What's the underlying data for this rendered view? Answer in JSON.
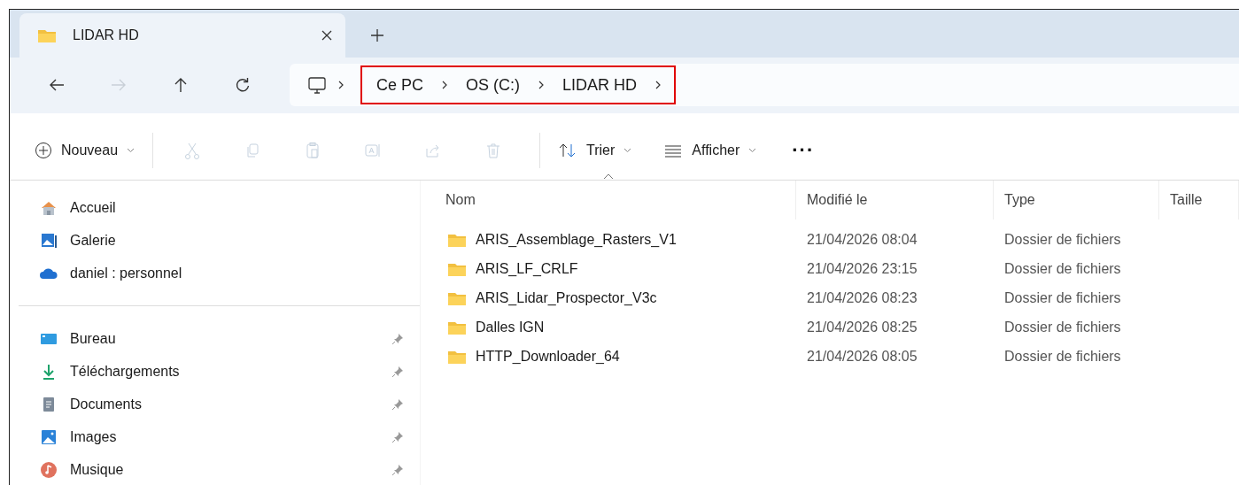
{
  "tab": {
    "title": "LIDAR HD",
    "selected": true
  },
  "nav_buttons": [
    {
      "kind": "back",
      "disabled": false
    },
    {
      "kind": "forward",
      "disabled": true
    },
    {
      "kind": "up",
      "disabled": false
    },
    {
      "kind": "refresh",
      "disabled": false
    }
  ],
  "breadcrumb": [
    "Ce PC",
    "OS (C:)",
    "LIDAR HD"
  ],
  "toolbar": {
    "new_label": "Nouveau",
    "actions": [
      {
        "kind": "cut",
        "disabled": true
      },
      {
        "kind": "copy",
        "disabled": true
      },
      {
        "kind": "paste",
        "disabled": true
      },
      {
        "kind": "rename",
        "disabled": true
      },
      {
        "kind": "share",
        "disabled": true
      },
      {
        "kind": "delete",
        "disabled": true
      }
    ],
    "sort_label": "Trier",
    "view_label": "Afficher",
    "more": "···"
  },
  "sidebar": {
    "groups": [
      [
        {
          "kind": "home",
          "label": "Accueil",
          "pinned": false
        },
        {
          "kind": "gallery",
          "label": "Galerie",
          "pinned": false
        },
        {
          "kind": "cloud",
          "label": "daniel : personnel",
          "pinned": false
        }
      ],
      [
        {
          "kind": "desktop",
          "label": "Bureau",
          "pinned": true
        },
        {
          "kind": "download",
          "label": "Téléchargements",
          "pinned": true
        },
        {
          "kind": "documents",
          "label": "Documents",
          "pinned": true
        },
        {
          "kind": "images",
          "label": "Images",
          "pinned": true
        },
        {
          "kind": "music",
          "label": "Musique",
          "pinned": true
        }
      ]
    ]
  },
  "table": {
    "columns": [
      {
        "label": "Nom",
        "sorted": true
      },
      {
        "label": "Modifié le",
        "sorted": false
      },
      {
        "label": "Type",
        "sorted": false
      },
      {
        "label": "Taille",
        "sorted": false
      }
    ],
    "rows": [
      [
        "ARIS_Assemblage_Rasters_V1",
        "21/04/2026 08:04",
        "Dossier de fichiers"
      ],
      [
        "ARIS_LF_CRLF",
        "21/04/2026 23:15",
        "Dossier de fichiers"
      ],
      [
        "ARIS_Lidar_Prospector_V3c",
        "21/04/2026 08:23",
        "Dossier de fichiers"
      ],
      [
        "Dalles IGN",
        "21/04/2026 08:25",
        "Dossier de fichiers"
      ],
      [
        "HTTP_Downloader_64",
        "21/04/2026 08:05",
        "Dossier de fichiers"
      ]
    ]
  }
}
